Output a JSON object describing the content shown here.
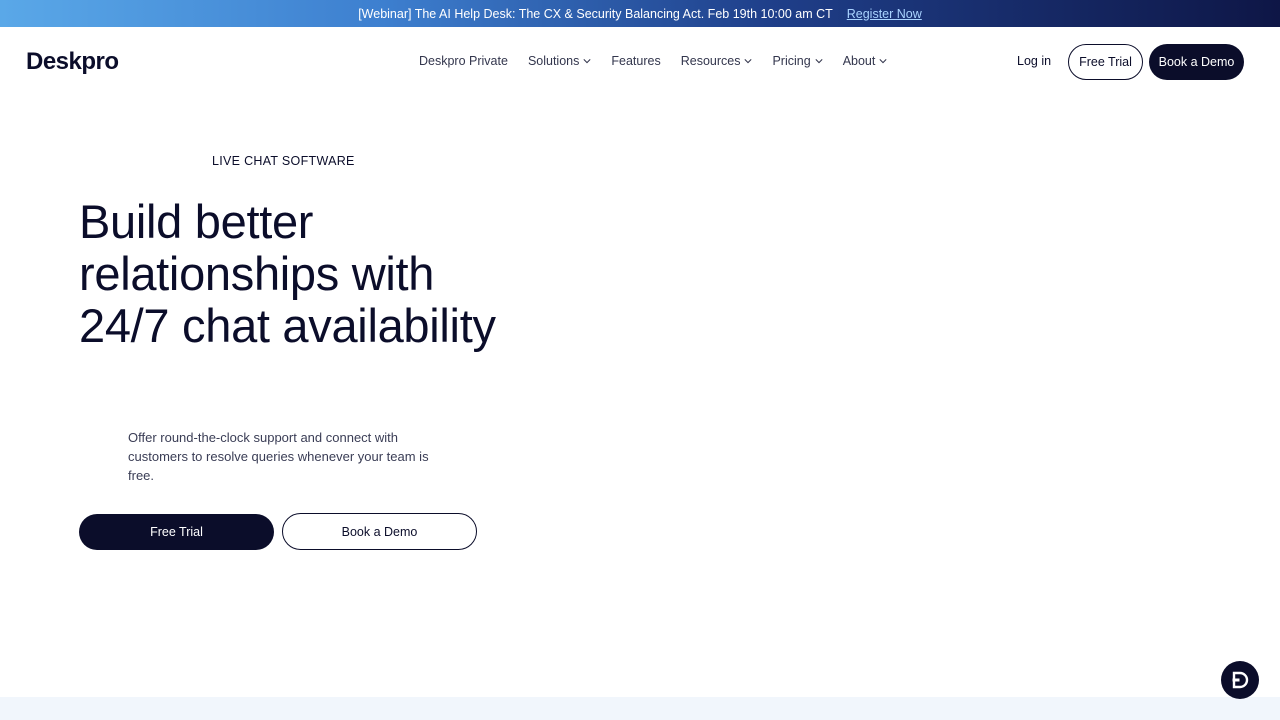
{
  "banner": {
    "text": "[Webinar] The AI Help Desk: The CX & Security Balancing Act. Feb 19th 10:00 am CT",
    "link_label": "Register Now"
  },
  "header": {
    "logo": "Deskpro",
    "nav": [
      {
        "label": "Deskpro Private",
        "dropdown": false
      },
      {
        "label": "Solutions",
        "dropdown": true
      },
      {
        "label": "Features",
        "dropdown": false
      },
      {
        "label": "Resources",
        "dropdown": true
      },
      {
        "label": "Pricing",
        "dropdown": true
      },
      {
        "label": "About",
        "dropdown": true
      }
    ],
    "login_label": "Log in",
    "free_trial_label": "Free Trial",
    "book_demo_label": "Book a Demo"
  },
  "hero": {
    "eyebrow": "LIVE CHAT SOFTWARE",
    "headline": "Build better relationships with 24/7 chat availability",
    "subtext": "Offer round-the-clock support and connect with customers to resolve queries whenever your team is free.",
    "primary_cta": "Free Trial",
    "secondary_cta": "Book a Demo"
  },
  "colors": {
    "brand_dark": "#0b0d2a",
    "banner_gradient_start": "#5aa8e8",
    "banner_gradient_end": "#0e1646",
    "link": "#a9d3ff"
  },
  "icons": {
    "chevron": "chevron-down-icon",
    "chat_widget": "deskpro-chat-icon"
  }
}
